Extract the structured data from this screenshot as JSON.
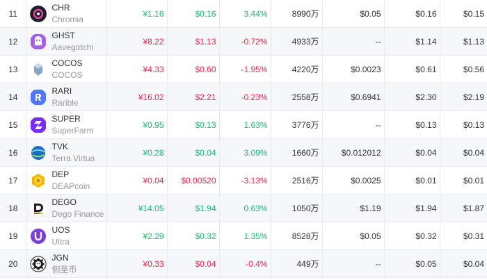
{
  "colors": {
    "up": "#1ebc73",
    "down": "#f0294a"
  },
  "rows": [
    {
      "rank": "11",
      "symbol": "CHR",
      "name": "Chromia",
      "icon": "chromia-icon",
      "price_cny": "¥1.16",
      "price_usd": "$0.16",
      "change": "3.44%",
      "dir": "up",
      "volume": "8990万",
      "c5": "$0.05",
      "c6": "$0.16",
      "c7": "$0.15"
    },
    {
      "rank": "12",
      "symbol": "GHST",
      "name": "Aavegotchi",
      "icon": "aavegotchi-icon",
      "price_cny": "¥8.22",
      "price_usd": "$1.13",
      "change": "-0.72%",
      "dir": "down",
      "volume": "4933万",
      "c5": "--",
      "c6": "$1.14",
      "c7": "$1.13"
    },
    {
      "rank": "13",
      "symbol": "COCOS",
      "name": "COCOS",
      "icon": "cocos-icon",
      "price_cny": "¥4.33",
      "price_usd": "$0.60",
      "change": "-1.95%",
      "dir": "down",
      "volume": "4220万",
      "c5": "$0.0023",
      "c6": "$0.61",
      "c7": "$0.56"
    },
    {
      "rank": "14",
      "symbol": "RARI",
      "name": "Rarible",
      "icon": "rarible-icon",
      "price_cny": "¥16.02",
      "price_usd": "$2.21",
      "change": "-0.23%",
      "dir": "down",
      "volume": "2558万",
      "c5": "$0.6941",
      "c6": "$2.30",
      "c7": "$2.19"
    },
    {
      "rank": "15",
      "symbol": "SUPER",
      "name": "SuperFarm",
      "icon": "superfarm-icon",
      "price_cny": "¥0.95",
      "price_usd": "$0.13",
      "change": "1.63%",
      "dir": "up",
      "volume": "3776万",
      "c5": "--",
      "c6": "$0.13",
      "c7": "$0.13"
    },
    {
      "rank": "16",
      "symbol": "TVK",
      "name": "Terra Virtua",
      "icon": "terra-virtua-icon",
      "price_cny": "¥0.28",
      "price_usd": "$0.04",
      "change": "3.09%",
      "dir": "up",
      "volume": "1660万",
      "c5": "$0.012012",
      "c6": "$0.04",
      "c7": "$0.04"
    },
    {
      "rank": "17",
      "symbol": "DEP",
      "name": "DEAPcoin",
      "icon": "deapcoin-icon",
      "price_cny": "¥0.04",
      "price_usd": "$0.00520",
      "change": "-3.13%",
      "dir": "down",
      "volume": "2516万",
      "c5": "$0.0025",
      "c6": "$0.01",
      "c7": "$0.01"
    },
    {
      "rank": "18",
      "symbol": "DEGO",
      "name": "Dego Finance",
      "icon": "dego-icon",
      "price_cny": "¥14.05",
      "price_usd": "$1.94",
      "change": "0.63%",
      "dir": "up",
      "volume": "1050万",
      "c5": "$1.19",
      "c6": "$1.94",
      "c7": "$1.87"
    },
    {
      "rank": "19",
      "symbol": "UOS",
      "name": "Ultra",
      "icon": "ultra-icon",
      "price_cny": "¥2.29",
      "price_usd": "$0.32",
      "change": "1.35%",
      "dir": "up",
      "volume": "8528万",
      "c5": "$0.05",
      "c6": "$0.32",
      "c7": "$0.31"
    },
    {
      "rank": "20",
      "symbol": "JGN",
      "name": "侧圣币",
      "icon": "jgn-lion-icon",
      "price_cny": "¥0.33",
      "price_usd": "$0.04",
      "change": "-0.4%",
      "dir": "down",
      "volume": "449万",
      "c5": "--",
      "c6": "$0.05",
      "c7": "$0.04"
    }
  ]
}
